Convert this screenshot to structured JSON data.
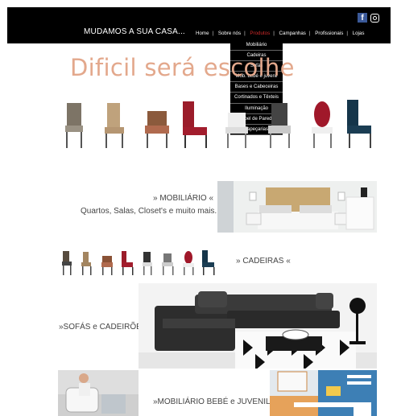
{
  "header": {
    "brand": "MUDAMOS A SUA CASA...",
    "nav": [
      "Home",
      "Sobre nós",
      "Produtos",
      "Campanhas",
      "Profissionais",
      "Lojas"
    ],
    "active_nav": "Produtos",
    "social": [
      "facebook-icon",
      "instagram-icon"
    ]
  },
  "dropdown": {
    "items": [
      "Mobiliário",
      "Cadeiras",
      "Sofás",
      "Mob. bebé e juvenil",
      "Bases e Cabeceiras",
      "Cortinados e Têxteis",
      "Iluminação",
      "Papel de Parede",
      "Tapeçarias"
    ]
  },
  "hero": {
    "title": "Dificil será escolhe"
  },
  "sections": {
    "mobiliario_title": "» MOBILIÁRIO «",
    "mobiliario_sub": "Quartos, Salas, Closet's e muito mais...",
    "cadeiras_title": "» CADEIRAS «",
    "sofas_title": "»SOFÁS e CADEIRÕES«",
    "bebe_title": "»MOBILIÁRIO BEBÉ e JUVENIL«"
  },
  "colors": {
    "accent_title": "#e3a88c",
    "active_nav": "#d12a2a",
    "bar": "#000000"
  }
}
